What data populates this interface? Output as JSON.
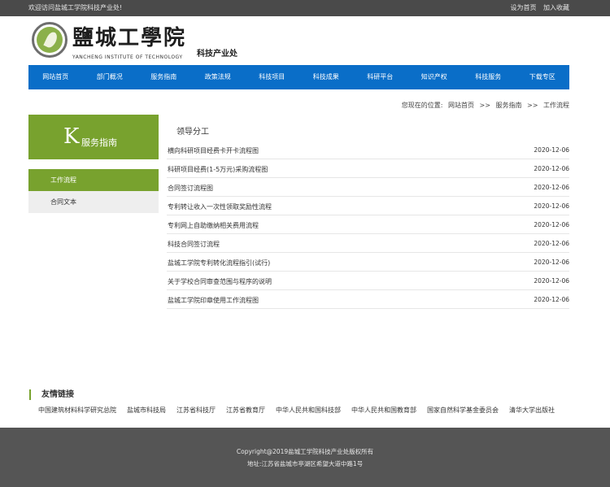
{
  "topbar": {
    "welcome": "欢迎访问盐城工学院科技产业处!",
    "set_home": "设为首页",
    "add_favorite": "加入收藏"
  },
  "header": {
    "school_name": "鹽城工學院",
    "school_name_en": "YANCHENG INSTITUTE OF TECHNOLOGY",
    "department": "科技产业处"
  },
  "nav": {
    "items": [
      "网站首页",
      "部门概况",
      "服务指南",
      "政策法规",
      "科技项目",
      "科技成果",
      "科研平台",
      "知识产权",
      "科技服务",
      "下载专区"
    ]
  },
  "breadcrumb": {
    "prefix": "您现在的位置:",
    "home": "网站首页",
    "sep1": ">>",
    "level1": "服务指南",
    "sep2": ">>",
    "current": "工作流程"
  },
  "sidebar": {
    "letter": "K",
    "title": "服务指南",
    "items": [
      {
        "label": "工作流程",
        "active": true
      },
      {
        "label": "合同文本",
        "active": false
      }
    ]
  },
  "main": {
    "section_title": "领导分工",
    "articles": [
      {
        "title": "横向科研项目经费卡开卡流程图",
        "date": "2020-12-06"
      },
      {
        "title": "科研项目经费(1-5万元)采购流程图",
        "date": "2020-12-06"
      },
      {
        "title": "合同签订流程图",
        "date": "2020-12-06"
      },
      {
        "title": "专利转让收入一次性领取奖励性流程",
        "date": "2020-12-06"
      },
      {
        "title": "专利网上自助缴纳相关费用流程",
        "date": "2020-12-06"
      },
      {
        "title": "科技合同签订流程",
        "date": "2020-12-06"
      },
      {
        "title": "盐城工学院专利转化流程指引(试行)",
        "date": "2020-12-06"
      },
      {
        "title": "关于学校合同审查范围与程序的说明",
        "date": "2020-12-06"
      },
      {
        "title": "盐城工学院印章使用工作流程图",
        "date": "2020-12-06"
      }
    ]
  },
  "friend_links": {
    "title": "友情链接",
    "items": [
      "中国建筑材料科学研究总院",
      "盐城市科技局",
      "江苏省科技厅",
      "江苏省教育厅",
      "中华人民共和国科技部",
      "中华人民共和国教育部",
      "国家自然科学基金委员会",
      "清华大学出版社"
    ]
  },
  "footer": {
    "copyright": "Copyright@2019盐城工学院科技产业处版权所有",
    "address": "地址:江苏省盐城市亭湖区希望大道中路1号"
  },
  "colors": {
    "nav_blue": "#0a6ec8",
    "accent_green": "#78a22e",
    "topbar": "#4a4a4a",
    "footer": "#555555"
  }
}
